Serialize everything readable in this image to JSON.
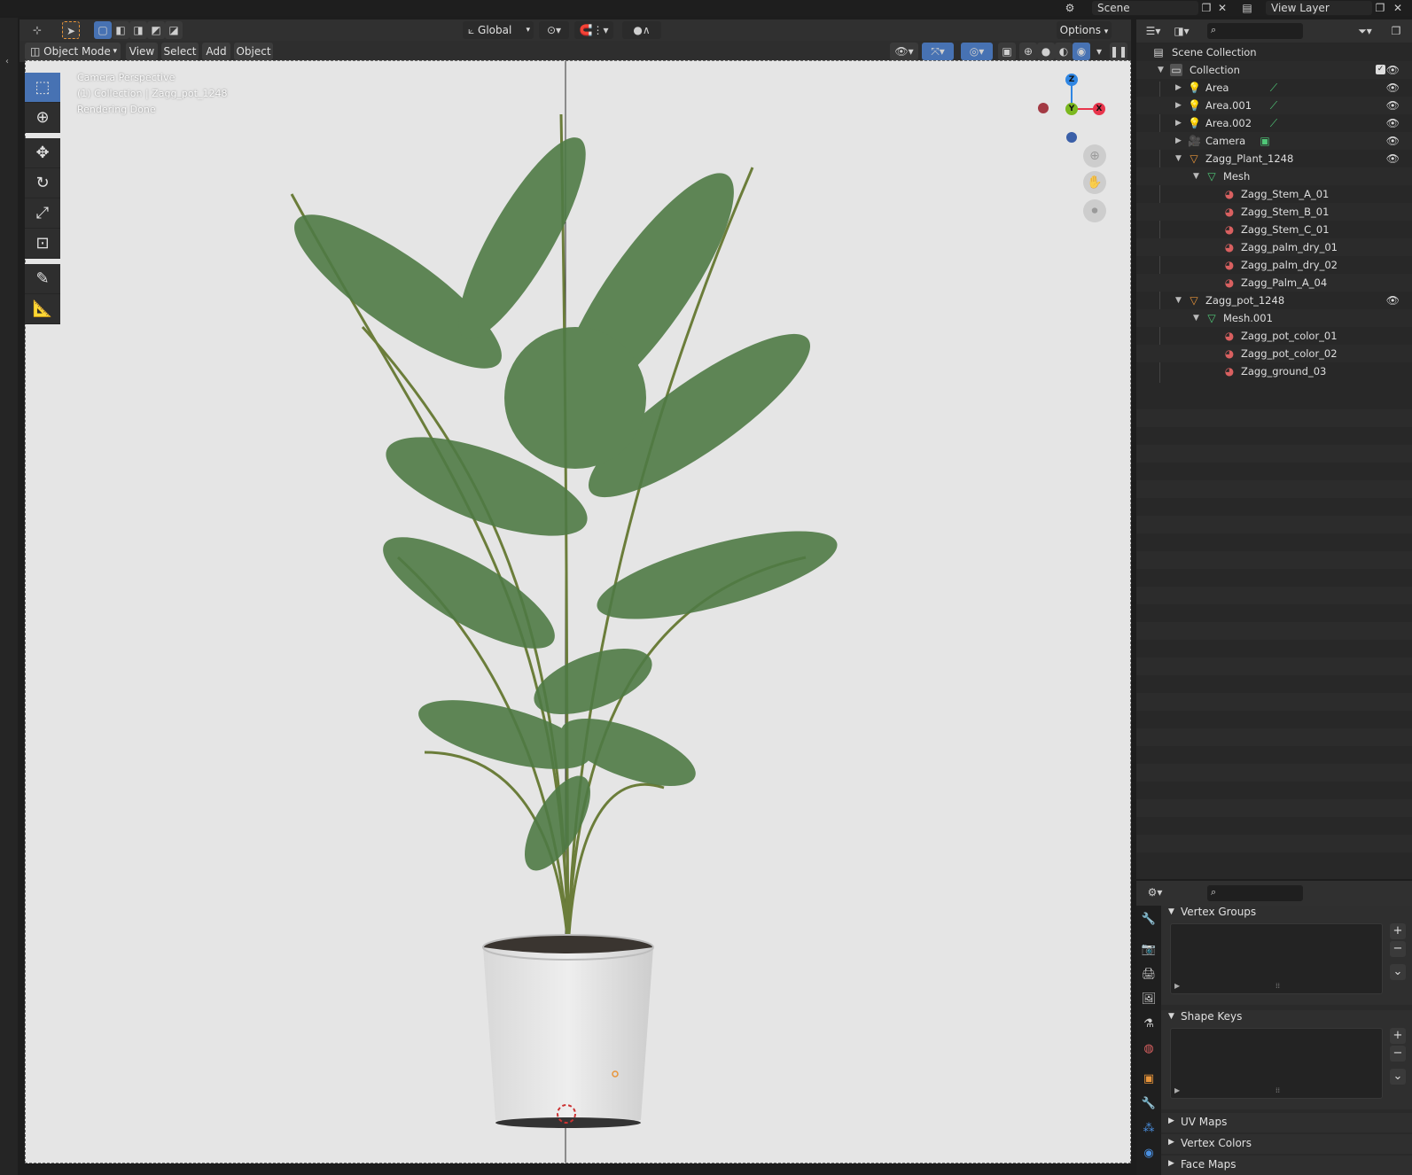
{
  "topbar": {
    "scene_label": "Scene",
    "view_layer_label": "View Layer"
  },
  "viewport_header": {
    "orientation": "Global",
    "options_label": "Options"
  },
  "viewport_menu": {
    "mode": "Object Mode",
    "view": "View",
    "select": "Select",
    "add": "Add",
    "object": "Object"
  },
  "viewport_overlay": {
    "line1": "Camera Perspective",
    "line2": "(1) Collection | Zagg_pot_1248",
    "line3": "Rendering Done"
  },
  "gizmo": {
    "z": "Z",
    "y": "Y",
    "x": "X",
    "colors": {
      "x": "#e8354c",
      "y": "#7bb81f",
      "z": "#2f86e3",
      "neg_x": "#a33a44",
      "neg_z": "#3a5fa8"
    }
  },
  "toolbar": {
    "tools": [
      "select-box-icon",
      "cursor-icon",
      "move-icon",
      "rotate-icon",
      "scale-icon",
      "transform-icon",
      "annotate-icon",
      "measure-icon"
    ]
  },
  "outliner": {
    "scene_collection": "Scene Collection",
    "collection": "Collection",
    "items": [
      {
        "label": "Area",
        "type": "light"
      },
      {
        "label": "Area.001",
        "type": "light"
      },
      {
        "label": "Area.002",
        "type": "light"
      },
      {
        "label": "Camera",
        "type": "camera"
      },
      {
        "label": "Zagg_Plant_1248",
        "type": "mesh-object"
      },
      {
        "label": "Mesh",
        "type": "mesh-data"
      },
      {
        "label": "Zagg_Stem_A_01",
        "type": "material"
      },
      {
        "label": "Zagg_Stem_B_01",
        "type": "material"
      },
      {
        "label": "Zagg_Stem_C_01",
        "type": "material"
      },
      {
        "label": "Zagg_palm_dry_01",
        "type": "material"
      },
      {
        "label": "Zagg_palm_dry_02",
        "type": "material"
      },
      {
        "label": "Zagg_Palm_A_04",
        "type": "material"
      },
      {
        "label": "Zagg_pot_1248",
        "type": "mesh-object"
      },
      {
        "label": "Mesh.001",
        "type": "mesh-data"
      },
      {
        "label": "Zagg_pot_color_01",
        "type": "material"
      },
      {
        "label": "Zagg_pot_color_02",
        "type": "material"
      },
      {
        "label": "Zagg_ground_03",
        "type": "material"
      }
    ]
  },
  "properties": {
    "vertex_groups": "Vertex Groups",
    "shape_keys": "Shape Keys",
    "uv_maps": "UV Maps",
    "vertex_colors": "Vertex Colors",
    "face_maps": "Face Maps"
  },
  "colors": {
    "accent": "#4772b3",
    "object_orange": "#e8953a",
    "mesh_green": "#50c878",
    "material_red": "#d96060"
  }
}
